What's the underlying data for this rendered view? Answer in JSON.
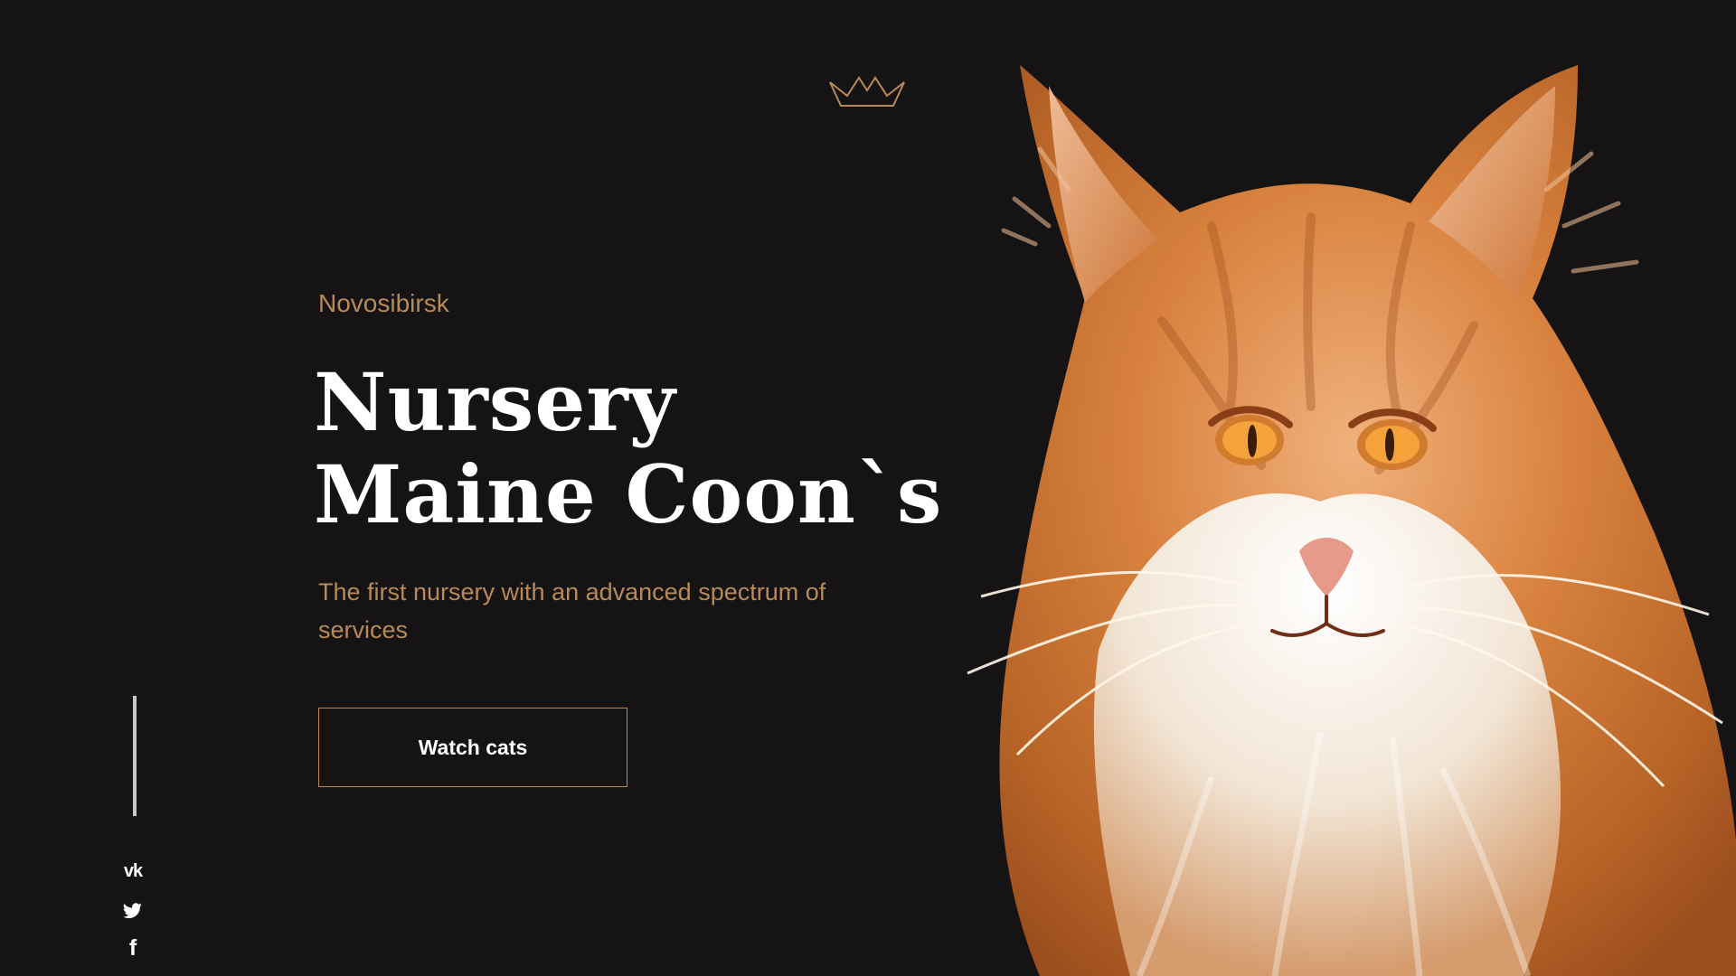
{
  "hero": {
    "city": "Novosibirsk",
    "title_line_1": "Nursery",
    "title_line_2": "Maine Coon`s",
    "subtitle": "The first nursery with an advanced spectrum of services",
    "button_label": "Watch cats"
  },
  "brand": {
    "icon": "crown-icon",
    "accent_color": "#b78a58",
    "background_color": "#151314"
  },
  "social": {
    "items": [
      {
        "name": "vk-icon",
        "glyph": "vk"
      },
      {
        "name": "twitter-icon",
        "glyph": "🐦"
      },
      {
        "name": "facebook-icon",
        "glyph": "f"
      }
    ]
  },
  "image": {
    "subject": "maine-coon-cat-image"
  }
}
